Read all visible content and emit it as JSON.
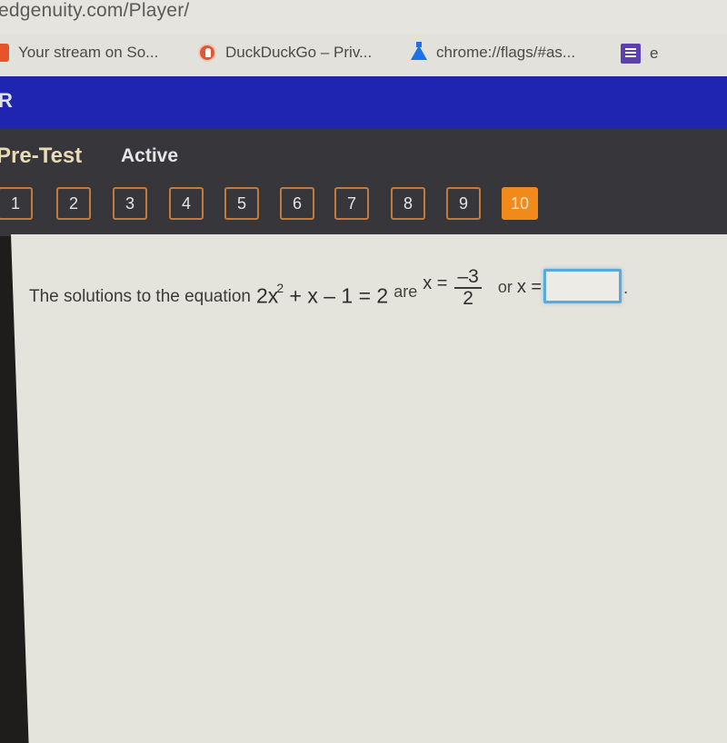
{
  "browser": {
    "url": "edgenuity.com/Player/",
    "bookmarks": [
      {
        "label": "Your stream on So...",
        "icon": "soundcloud-icon"
      },
      {
        "label": "DuckDuckGo – Priv...",
        "icon": "duckduckgo-icon"
      },
      {
        "label": "chrome://flags/#as...",
        "icon": "flask-icon"
      },
      {
        "label": "e",
        "icon": "list-icon"
      }
    ]
  },
  "app": {
    "header_letter": "R",
    "header_color": "#1f25b0",
    "test_title": "Pre-Test",
    "status": "Active",
    "accent_color": "#f08a1a",
    "questions": [
      "1",
      "2",
      "3",
      "4",
      "5",
      "6",
      "7",
      "8",
      "9",
      "10"
    ],
    "current_question": "10"
  },
  "question": {
    "intro": "The solutions to the equation",
    "equation_lhs_coef": "2x",
    "equation_exponent": "2",
    "equation_rest": " + x – 1 = 2",
    "are": "are",
    "x_equals": "x =",
    "fraction_numerator": "–3",
    "fraction_denominator": "2",
    "or": "or",
    "x_var": "x =",
    "answer_value": "",
    "period": "."
  }
}
